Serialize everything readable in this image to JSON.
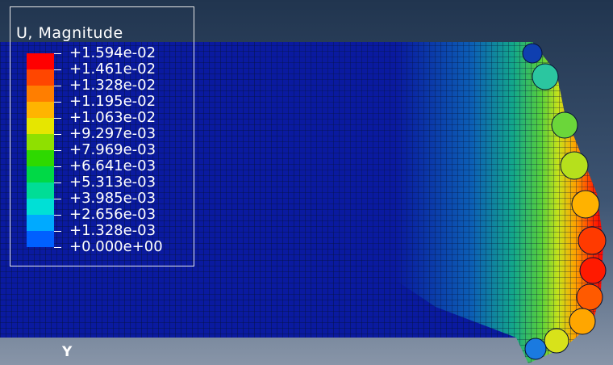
{
  "viewport": {
    "background_top": "#21354f",
    "background_bottom": "#8895a8",
    "mesh_line_color": "#061233"
  },
  "legend": {
    "title": "U, Magnitude",
    "entries": [
      {
        "label": "+1.594e-02",
        "color": "#ff0000"
      },
      {
        "label": "+1.461e-02",
        "color": "#ff4600"
      },
      {
        "label": "+1.328e-02",
        "color": "#ff7e00"
      },
      {
        "label": "+1.195e-02",
        "color": "#ffb400"
      },
      {
        "label": "+1.063e-02",
        "color": "#e6e600"
      },
      {
        "label": "+9.297e-03",
        "color": "#8fe000"
      },
      {
        "label": "+7.969e-03",
        "color": "#2ed900"
      },
      {
        "label": "+6.641e-03",
        "color": "#00d946"
      },
      {
        "label": "+5.313e-03",
        "color": "#00dd96"
      },
      {
        "label": "+3.985e-03",
        "color": "#00e0d6"
      },
      {
        "label": "+2.656e-03",
        "color": "#00aaff"
      },
      {
        "label": "+1.328e-03",
        "color": "#0060ff"
      },
      {
        "label": "+0.000e+00",
        "color": "#0018ff"
      }
    ]
  },
  "triad": {
    "axis_label": "Y"
  }
}
